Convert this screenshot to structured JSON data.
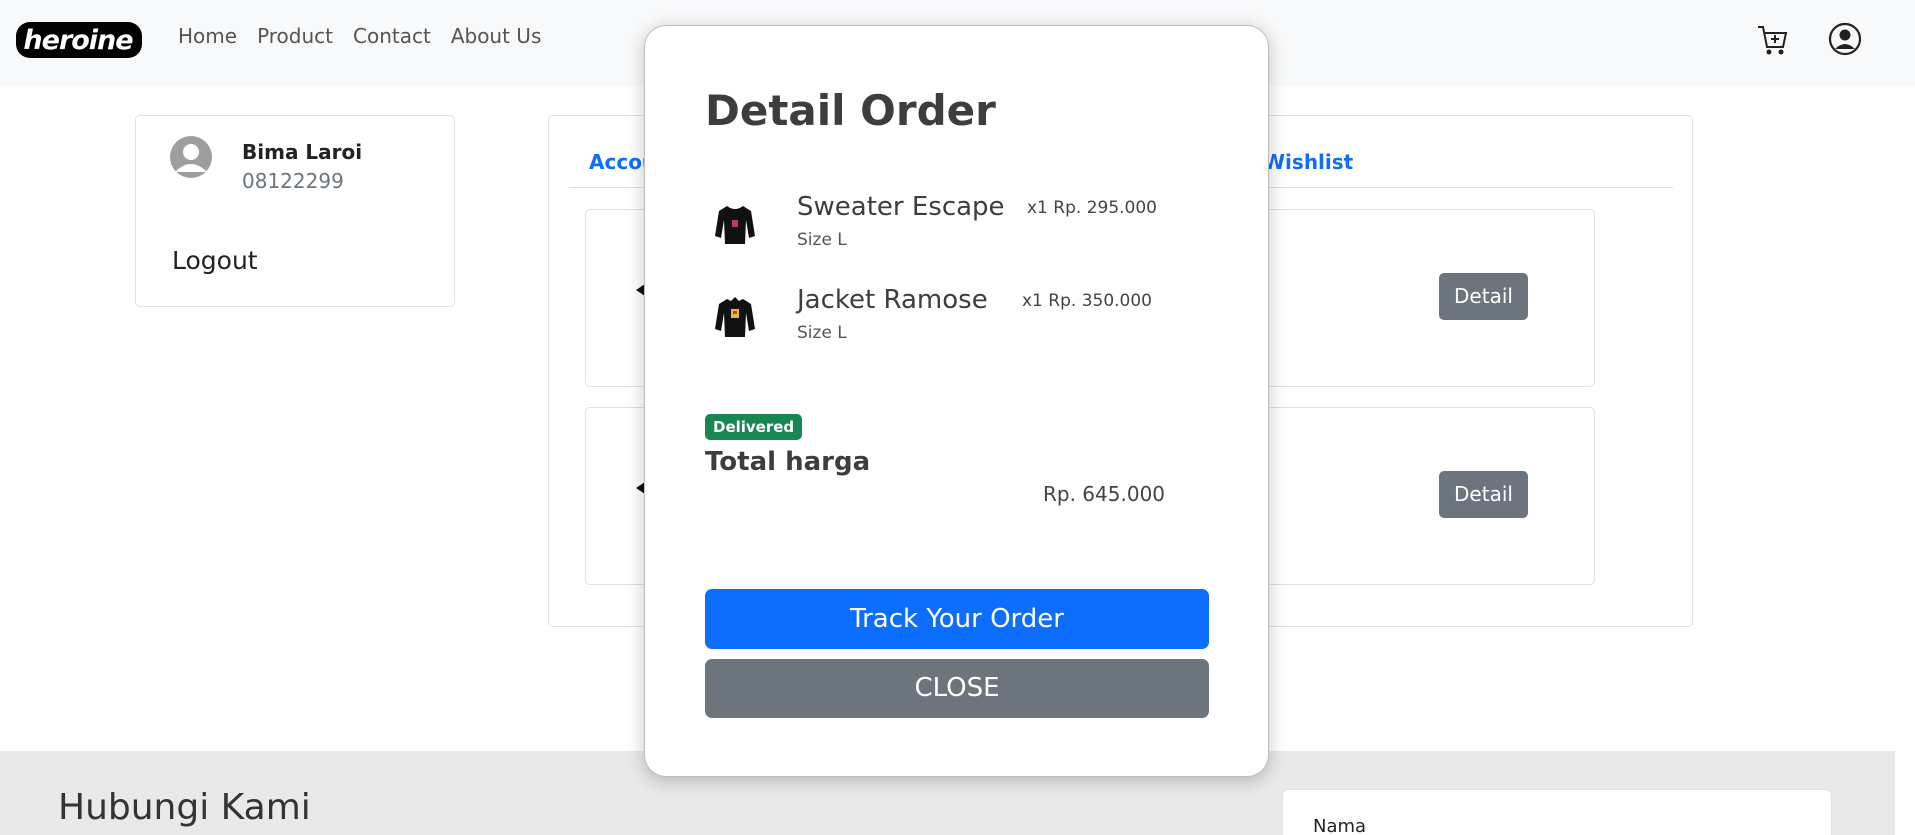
{
  "navbar": {
    "logo_text": "heroine",
    "links": [
      "Home",
      "Product",
      "Contact",
      "About Us"
    ]
  },
  "profile": {
    "name": "Bima Laroi",
    "phone": "08122299",
    "logout_label": "Logout"
  },
  "tabs": {
    "account_partial": "Accou",
    "wishlist_partial": "Wishlist"
  },
  "orders": [
    {
      "detail_label": "Detail"
    },
    {
      "detail_label": "Detail"
    }
  ],
  "footer": {
    "title": "Hubungi Kami",
    "name_label": "Nama"
  },
  "modal": {
    "title": "Detail Order",
    "items": [
      {
        "name": "Sweater Escape",
        "size": "Size L",
        "qty_price": "x1 Rp. 295.000"
      },
      {
        "name": "Jacket Ramose",
        "size": "Size L",
        "qty_price": "x1 Rp. 350.000"
      }
    ],
    "status": "Delivered",
    "total_label": "Total harga",
    "total_value": "Rp. 645.000",
    "track_label": "Track Your Order",
    "close_label": "CLOSE"
  },
  "colors": {
    "primary": "#0d6efd",
    "secondary": "#6c757d",
    "success": "#198754"
  }
}
